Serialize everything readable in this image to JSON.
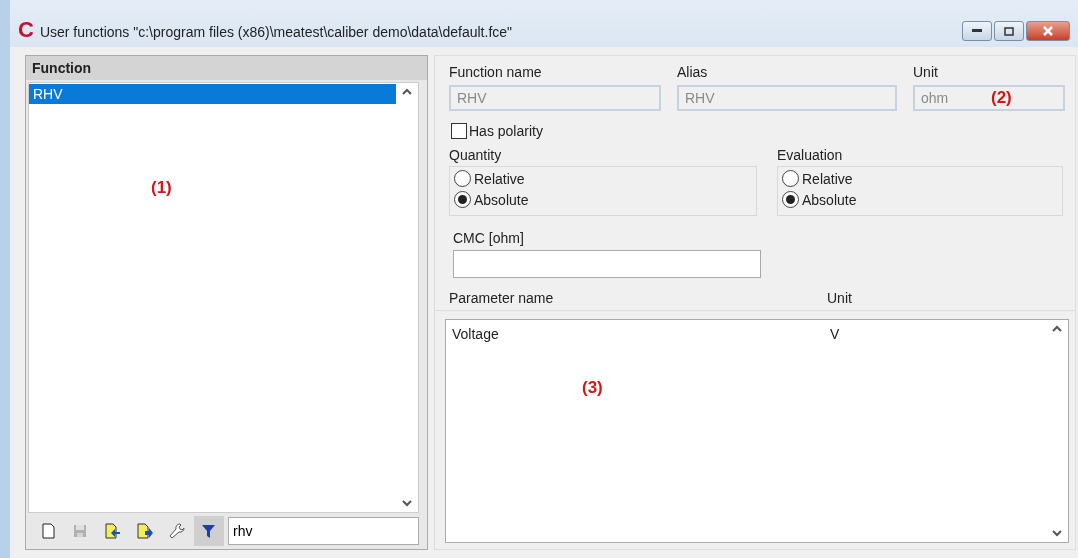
{
  "window": {
    "logo": "C",
    "title": "User functions \"c:\\program files (x86)\\meatest\\caliber demo\\data\\default.fce\""
  },
  "function_list": {
    "header": "Function",
    "annotation": "(1)",
    "items": [
      {
        "label": "RHV",
        "selected": true
      }
    ]
  },
  "toolbar": {
    "buttons": [
      {
        "kind": "new",
        "disabled": false,
        "pressed": false
      },
      {
        "kind": "save",
        "disabled": true,
        "pressed": false
      },
      {
        "kind": "import",
        "disabled": false,
        "pressed": false
      },
      {
        "kind": "export",
        "disabled": false,
        "pressed": false
      },
      {
        "kind": "tools",
        "disabled": false,
        "pressed": false
      },
      {
        "kind": "filter",
        "disabled": false,
        "pressed": true
      }
    ],
    "filter_field": {
      "value": "rhv"
    }
  },
  "fields": [
    {
      "label": "Function name",
      "value": "RHV",
      "disabled": true
    },
    {
      "label": "Alias",
      "value": "RHV",
      "disabled": true
    },
    {
      "label": "Unit",
      "value": "ohm",
      "disabled": true,
      "annotation": "(2)"
    }
  ],
  "has_polarity": {
    "label": "Has polarity",
    "checked": false
  },
  "groups": [
    {
      "label": "Quantity",
      "options": [
        {
          "label": "Relative",
          "selected": false
        },
        {
          "label": "Absolute",
          "selected": true
        }
      ]
    },
    {
      "label": "Evaluation",
      "options": [
        {
          "label": "Relative",
          "selected": false
        },
        {
          "label": "Absolute",
          "selected": true
        }
      ]
    }
  ],
  "cmc": {
    "label": "CMC [ohm]"
  },
  "parameters": {
    "columns": [
      "Parameter name",
      "Unit"
    ],
    "annotation": "(3)",
    "rows": [
      {
        "cells": [
          "Voltage",
          "V"
        ]
      }
    ]
  }
}
